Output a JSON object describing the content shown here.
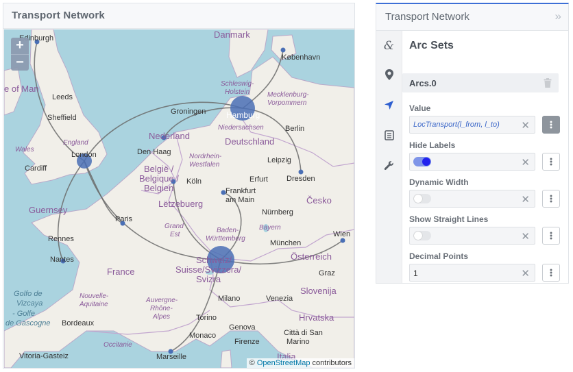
{
  "map_panel": {
    "title": "Transport Network",
    "zoom_in": "+",
    "zoom_out": "−",
    "attribution_prefix": "© ",
    "attribution_link": "OpenStreetMap",
    "attribution_suffix": " contributors",
    "labels": {
      "edinburgh": "Edinburgh",
      "isle_of_man": "e of Man",
      "leeds": "Leeds",
      "sheffield": "Sheffield",
      "england": "England",
      "wales": "Wales",
      "london": "London",
      "cardiff": "Cardiff",
      "guernsey": "Guernsey",
      "rennes": "Rennes",
      "nantes": "Nantes",
      "golfo_1": "Golfo de",
      "golfo_2": "Vizcaya",
      "golfo_3": "- Golfe",
      "golfo_4": "de Gascogne",
      "bordeaux": "Bordeaux",
      "vitoria": "Vitoria-Gasteiz",
      "paris": "Paris",
      "france": "France",
      "nouvelle_1": "Nouvelle-",
      "nouvelle_2": "Aquitaine",
      "auvergne_1": "Auvergne-",
      "auvergne_2": "Rhône-",
      "auvergne_3": "Alpes",
      "occitanie": "Occitanie",
      "marseille": "Marseille",
      "monaco": "Monaco",
      "torino": "Torino",
      "genova": "Genova",
      "milano": "Milano",
      "venezia": "Venezia",
      "firenze": "Firenze",
      "san_marino_1": "Città di San",
      "san_marino_2": "Marino",
      "italia": "Italia",
      "hrvatska": "Hrvatska",
      "slovenija": "Slovenija",
      "graz": "Graz",
      "wien": "Wien",
      "osterreich": "Österreich",
      "munchen": "München",
      "nurnberg": "Nürnberg",
      "bayern": "Bayern",
      "schweiz_1": "Schweiz/",
      "schweiz_2": "Suisse/Svizzera/",
      "schweiz_3": "Svizra",
      "baden_1": "Baden-",
      "baden_2": "Württemberg",
      "grand_est_1": "Grand",
      "grand_est_2": "Est",
      "letzebuerg": "Lëtzebuerg",
      "belgie_1": "België /",
      "belgie_2": "Belgique /",
      "belgie_3": "Belgien",
      "koln": "Köln",
      "frankfurt_1": "Frankfurt",
      "frankfurt_2": "am Main",
      "erfurt": "Erfurt",
      "leipzig": "Leipzig",
      "dresden": "Dresden",
      "cesko": "Česko",
      "nrw_1": "Nordrhein-",
      "nrw_2": "Westfalen",
      "den_haag": "Den Haag",
      "nederland": "Nederland",
      "groningen": "Groningen",
      "hamburg": "Hamburg",
      "niedersachsen": "Niedersachsen",
      "deutschland": "Deutschland",
      "berlin": "Berlin",
      "schleswig_1": "Schleswig-",
      "schleswig_2": "Holstein",
      "mecklenburg_1": "Mecklenburg-",
      "mecklenburg_2": "Vorpommern",
      "danmark": "Danmark",
      "kobenhavn": "København"
    }
  },
  "side_panel": {
    "title": "Transport Network",
    "collapse_icon": "»",
    "section_title": "Arc Sets",
    "arc_set_name": "Arcs.0",
    "fields": [
      {
        "label": "Value",
        "value": "LocTransport(l_from, l_to)",
        "kind": "expression"
      },
      {
        "label": "Hide Labels",
        "toggle": true,
        "kind": "toggle"
      },
      {
        "label": "Dynamic Width",
        "toggle": false,
        "kind": "toggle"
      },
      {
        "label": "Show Straight Lines",
        "toggle": false,
        "kind": "toggle"
      },
      {
        "label": "Decimal Points",
        "value": "1",
        "kind": "number"
      }
    ],
    "clear_glyph": "✕"
  },
  "icons": {
    "tab_1": "ampersand-icon",
    "tab_2": "map-marker-icon",
    "tab_3": "location-arrow-icon",
    "tab_4": "list-icon",
    "tab_5": "wrench-icon"
  },
  "colors": {
    "accent": "#3d6fd6",
    "hub": "#4a6fb5",
    "arc": "#6b6b6b",
    "water": "#aad3df",
    "land": "#f1efe9"
  }
}
